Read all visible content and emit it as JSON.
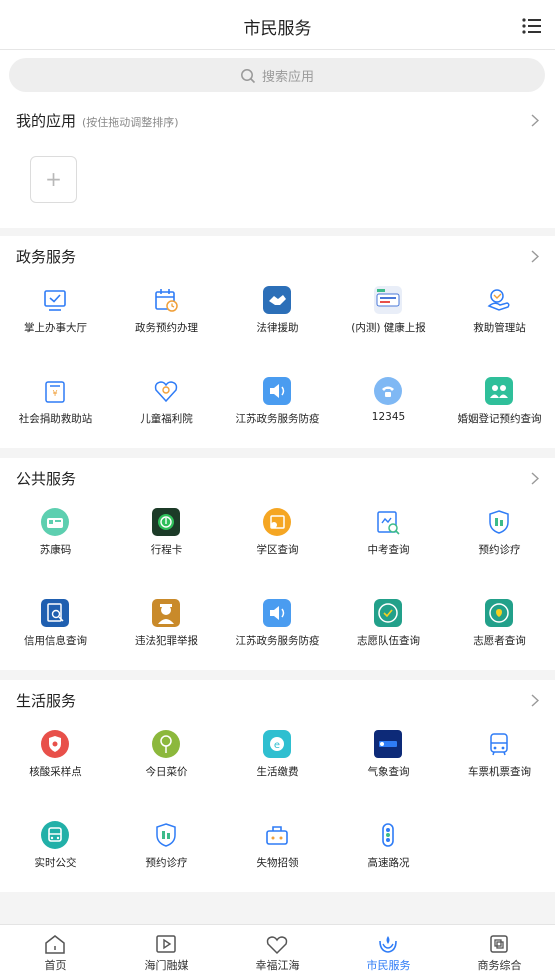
{
  "header": {
    "title": "市民服务",
    "menu_icon": "list-menu-icon"
  },
  "search": {
    "placeholder": "搜索应用"
  },
  "my_apps": {
    "title": "我的应用",
    "hint": "(按住拖动调整排序)",
    "add_label": "+"
  },
  "sections": [
    {
      "title": "政务服务",
      "items": [
        {
          "label": "掌上办事大厅",
          "icon": "monitor-check-icon"
        },
        {
          "label": "政务预约办理",
          "icon": "calendar-clock-icon"
        },
        {
          "label": "法律援助",
          "icon": "handshake-icon"
        },
        {
          "label": "(内测) 健康上报",
          "icon": "health-report-icon"
        },
        {
          "label": "救助管理站",
          "icon": "hands-care-icon"
        },
        {
          "label": "社会捐助救助站",
          "icon": "donation-box-icon"
        },
        {
          "label": "儿童福利院",
          "icon": "heart-child-icon"
        },
        {
          "label": "江苏政务服务防疫",
          "icon": "speaker-icon"
        },
        {
          "label": "12345",
          "icon": "phone-hotline-icon"
        },
        {
          "label": "婚姻登记预约查询",
          "icon": "couple-icon"
        }
      ]
    },
    {
      "title": "公共服务",
      "items": [
        {
          "label": "苏康码",
          "icon": "sukang-code-icon"
        },
        {
          "label": "行程卡",
          "icon": "trip-card-icon"
        },
        {
          "label": "学区查询",
          "icon": "school-district-icon"
        },
        {
          "label": "中考查询",
          "icon": "exam-search-icon"
        },
        {
          "label": "预约诊疗",
          "icon": "hospital-shield-icon"
        },
        {
          "label": "信用信息查询",
          "icon": "credit-doc-icon"
        },
        {
          "label": "违法犯罪举报",
          "icon": "police-report-icon"
        },
        {
          "label": "江苏政务服务防疫",
          "icon": "speaker-icon"
        },
        {
          "label": "志愿队伍查询",
          "icon": "volunteer-team-icon"
        },
        {
          "label": "志愿者查询",
          "icon": "volunteer-icon"
        }
      ]
    },
    {
      "title": "生活服务",
      "items": [
        {
          "label": "核酸采样点",
          "icon": "nucleic-test-icon"
        },
        {
          "label": "今日菜价",
          "icon": "vegetable-icon"
        },
        {
          "label": "生活缴费",
          "icon": "bill-payment-icon"
        },
        {
          "label": "气象查询",
          "icon": "weather-icon"
        },
        {
          "label": "车票机票查询",
          "icon": "ticket-bus-icon"
        },
        {
          "label": "实时公交",
          "icon": "bus-icon"
        },
        {
          "label": "预约诊疗",
          "icon": "hospital-shield-icon"
        },
        {
          "label": "失物招领",
          "icon": "lost-found-icon"
        },
        {
          "label": "高速路况",
          "icon": "traffic-light-icon"
        }
      ]
    }
  ],
  "tabbar": [
    {
      "label": "首页",
      "icon": "home-icon",
      "active": false
    },
    {
      "label": "海门融媒",
      "icon": "media-play-icon",
      "active": false
    },
    {
      "label": "幸福江海",
      "icon": "heart-outline-icon",
      "active": false
    },
    {
      "label": "市民服务",
      "icon": "citizen-service-icon",
      "active": true
    },
    {
      "label": "商务综合",
      "icon": "business-icon",
      "active": false
    }
  ],
  "colors": {
    "active_tab": "#2f7cf6",
    "icon_blue": "#2f7cf6",
    "icon_green": "#3dbb8a",
    "icon_orange": "#f0a03a",
    "icon_red": "#e8504a",
    "icon_olive": "#8cb83c"
  }
}
